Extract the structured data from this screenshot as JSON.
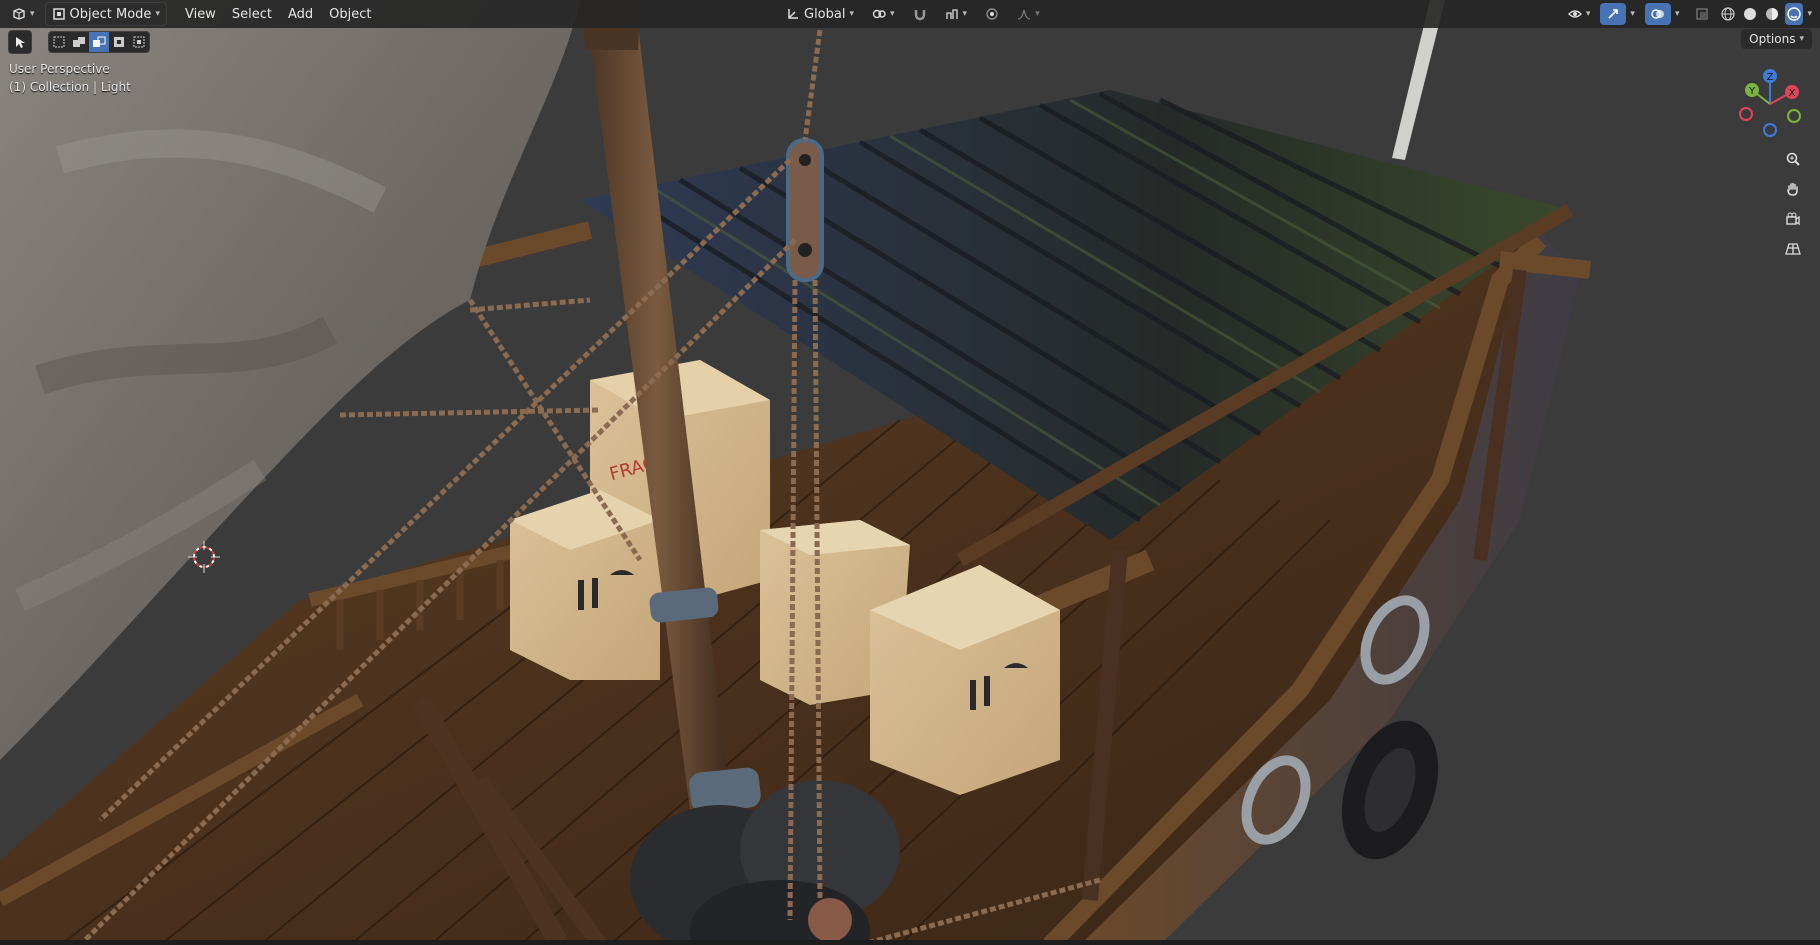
{
  "header": {
    "mode": "Object Mode",
    "menus": [
      "View",
      "Select",
      "Add",
      "Object"
    ],
    "transform_orientation": "Global",
    "options_label": "Options"
  },
  "viewport": {
    "perspective_label": "User Perspective",
    "collection_label": "(1) Collection | Light"
  },
  "gizmo": {
    "z": "Z",
    "y": "Y",
    "x": "X"
  },
  "colors": {
    "header_bg": "#262626",
    "accent": "#4772b3",
    "axis_x": "#e0445a",
    "axis_y": "#7cb342",
    "axis_z": "#3d7dd8"
  },
  "icons": {
    "editor_type": "viewport-editor-icon",
    "cursor": "3d-cursor-icon"
  }
}
